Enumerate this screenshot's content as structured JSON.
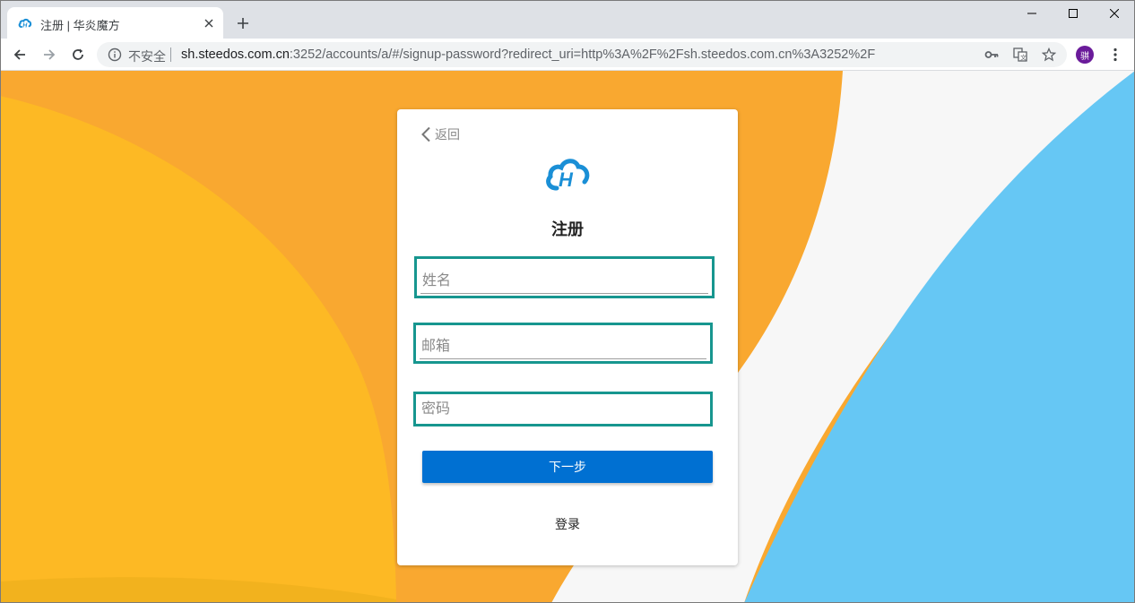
{
  "browser": {
    "tab_title": "注册 | 华炎魔方",
    "security_label": "不安全",
    "url_host": "sh.steedos.com.cn",
    "url_rest": ":3252/accounts/a/#/signup-password?redirect_uri=http%3A%2F%2Fsh.steedos.com.cn%3A3252%2F",
    "profile_initial": "骐"
  },
  "form": {
    "back_label": "返回",
    "title": "注册",
    "name_placeholder": "姓名",
    "email_placeholder": "邮箱",
    "password_placeholder": "密码",
    "next_label": "下一步",
    "login_label": "登录"
  },
  "colors": {
    "accent_button": "#0070d2",
    "field_border": "#17968f",
    "bg_orange": "#f9a830",
    "bg_yellow": "#fdb924",
    "bg_blue": "#66c7f4",
    "bg_light": "#f7f7f7"
  }
}
